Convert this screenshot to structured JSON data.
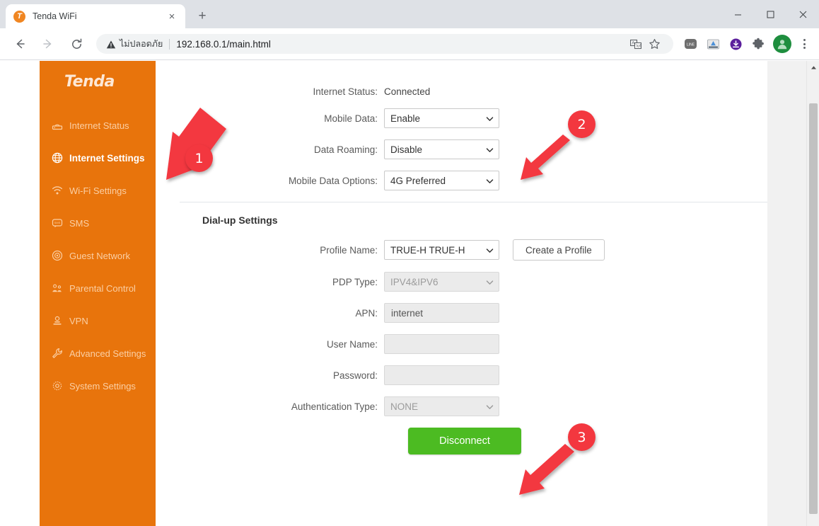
{
  "browser": {
    "tab": {
      "title": "Tenda WiFi",
      "favicon": "tenda-favicon",
      "close_label": "×"
    },
    "new_tab_label": "+",
    "window_controls": {
      "minimize": "—",
      "maximize": "□",
      "close": "✕"
    },
    "nav": {
      "back": "←",
      "forward": "→",
      "reload": "↻"
    },
    "omnibox": {
      "security_text": "ไม่ปลอดภัย",
      "security_icon": "warning-triangle-icon",
      "url": "192.168.0.1/main.html",
      "translate_icon": "translate-icon",
      "bookmark_icon": "star-icon"
    },
    "extensions": [
      {
        "name": "line-extension-icon",
        "glyph": "◯",
        "color": "#707070"
      },
      {
        "name": "app-extension-icon",
        "glyph": "▣",
        "color": "#4a90d9"
      },
      {
        "name": "download-icon",
        "glyph": "⬇",
        "color": "#6a1b9a"
      },
      {
        "name": "puzzle-extension-icon",
        "glyph": "❖",
        "color": "#5f6368"
      }
    ],
    "avatar_icon": "profile-avatar",
    "menu_icon": "three-dot-menu-icon"
  },
  "router": {
    "brand": "Tenda",
    "sidebar": {
      "items": [
        {
          "label": "Internet Status",
          "icon": "router-icon",
          "active": false
        },
        {
          "label": "Internet Settings",
          "icon": "globe-icon",
          "active": true
        },
        {
          "label": "Wi-Fi Settings",
          "icon": "wifi-icon",
          "active": false
        },
        {
          "label": "SMS",
          "icon": "sms-icon",
          "active": false
        },
        {
          "label": "Guest Network",
          "icon": "guest-icon",
          "active": false
        },
        {
          "label": "Parental Control",
          "icon": "family-icon",
          "active": false
        },
        {
          "label": "VPN",
          "icon": "vpn-lock-icon",
          "active": false
        },
        {
          "label": "Advanced Settings",
          "icon": "wrench-icon",
          "active": false
        },
        {
          "label": "System Settings",
          "icon": "gear-icon",
          "active": false
        }
      ]
    },
    "top_form": {
      "internet_status": {
        "label": "Internet Status:",
        "value": "Connected"
      },
      "mobile_data": {
        "label": "Mobile Data:",
        "value": "Enable",
        "disabled": false
      },
      "data_roaming": {
        "label": "Data Roaming:",
        "value": "Disable",
        "disabled": false
      },
      "mobile_options": {
        "label": "Mobile Data Options:",
        "value": "4G Preferred",
        "disabled": false
      }
    },
    "dialup": {
      "section_title": "Dial-up Settings",
      "profile_name": {
        "label": "Profile Name:",
        "value": "TRUE-H TRUE-H",
        "disabled": false
      },
      "create_profile_label": "Create a Profile",
      "pdp_type": {
        "label": "PDP Type:",
        "value": "IPV4&IPV6",
        "disabled": true
      },
      "apn": {
        "label": "APN:",
        "value": "internet",
        "disabled": true
      },
      "user_name": {
        "label": "User Name:",
        "value": "",
        "disabled": true
      },
      "password": {
        "label": "Password:",
        "value": "",
        "disabled": true
      },
      "auth_type": {
        "label": "Authentication Type:",
        "value": "NONE",
        "disabled": true
      }
    },
    "disconnect_label": "Disconnect"
  },
  "annotations": {
    "markers": [
      {
        "number": "1",
        "points_to": "sidebar-item-internet-settings"
      },
      {
        "number": "2",
        "points_to": "data-roaming-select"
      },
      {
        "number": "3",
        "points_to": "disconnect-button"
      }
    ]
  },
  "colors": {
    "brand_orange": "#e8740c",
    "sidebar_inactive_text": "#fbcfa4",
    "annotation_red": "#f3373f",
    "disconnect_green": "#4cbb22",
    "chrome_tabstrip": "#dee1e6"
  }
}
